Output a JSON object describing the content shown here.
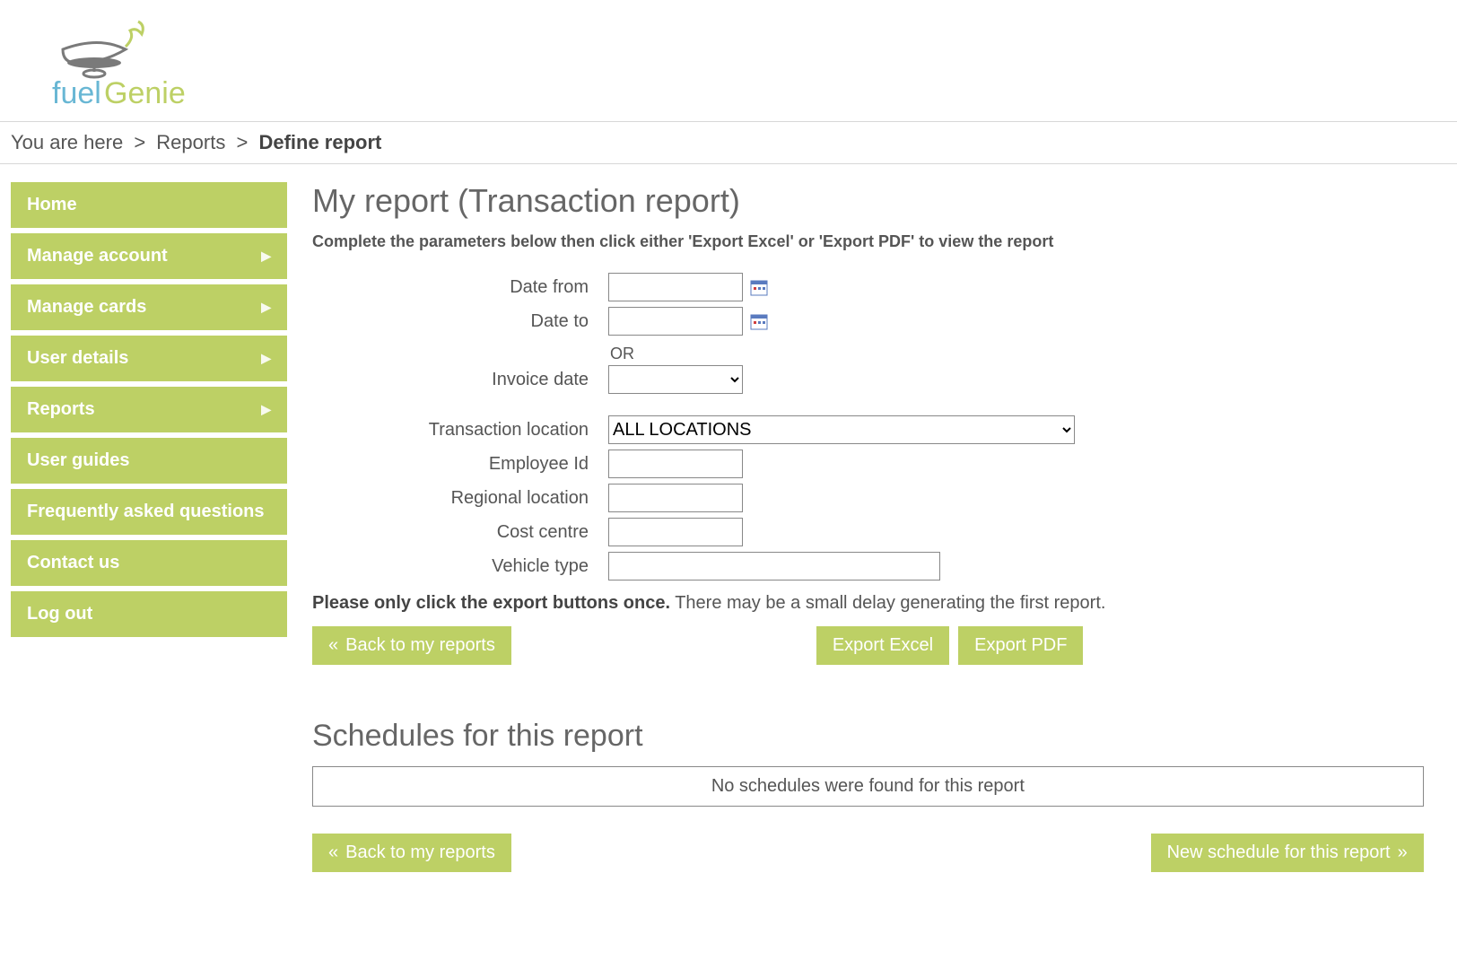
{
  "brand": {
    "name_part1": "fuel",
    "name_part2": "Genie"
  },
  "breadcrumb": {
    "prefix": "You are here",
    "items": [
      "Reports"
    ],
    "current": "Define report"
  },
  "sidebar": {
    "items": [
      {
        "label": "Home",
        "has_submenu": false
      },
      {
        "label": "Manage account",
        "has_submenu": true
      },
      {
        "label": "Manage cards",
        "has_submenu": true
      },
      {
        "label": "User details",
        "has_submenu": true
      },
      {
        "label": "Reports",
        "has_submenu": true
      },
      {
        "label": "User guides",
        "has_submenu": false
      },
      {
        "label": "Frequently asked questions",
        "has_submenu": false
      },
      {
        "label": "Contact us",
        "has_submenu": false
      },
      {
        "label": "Log out",
        "has_submenu": false
      }
    ]
  },
  "page": {
    "title": "My report (Transaction report)",
    "instructions": "Complete the parameters below then click either 'Export Excel' or 'Export PDF' to view the report"
  },
  "form": {
    "date_from": {
      "label": "Date from",
      "value": ""
    },
    "date_to": {
      "label": "Date to",
      "value": ""
    },
    "or_text": "OR",
    "invoice_date": {
      "label": "Invoice date",
      "value": ""
    },
    "transaction_location": {
      "label": "Transaction location",
      "selected": "ALL LOCATIONS"
    },
    "employee_id": {
      "label": "Employee Id",
      "value": ""
    },
    "regional_location": {
      "label": "Regional location",
      "value": ""
    },
    "cost_centre": {
      "label": "Cost centre",
      "value": ""
    },
    "vehicle_type": {
      "label": "Vehicle type",
      "value": ""
    }
  },
  "note": {
    "bold": "Please only click the export buttons once.",
    "rest": " There may be a small delay generating the first report."
  },
  "buttons": {
    "back": "Back to my reports",
    "export_excel": "Export Excel",
    "export_pdf": "Export PDF",
    "new_schedule": "New schedule for this report"
  },
  "schedules": {
    "title": "Schedules for this report",
    "empty_message": "No schedules were found for this report"
  }
}
